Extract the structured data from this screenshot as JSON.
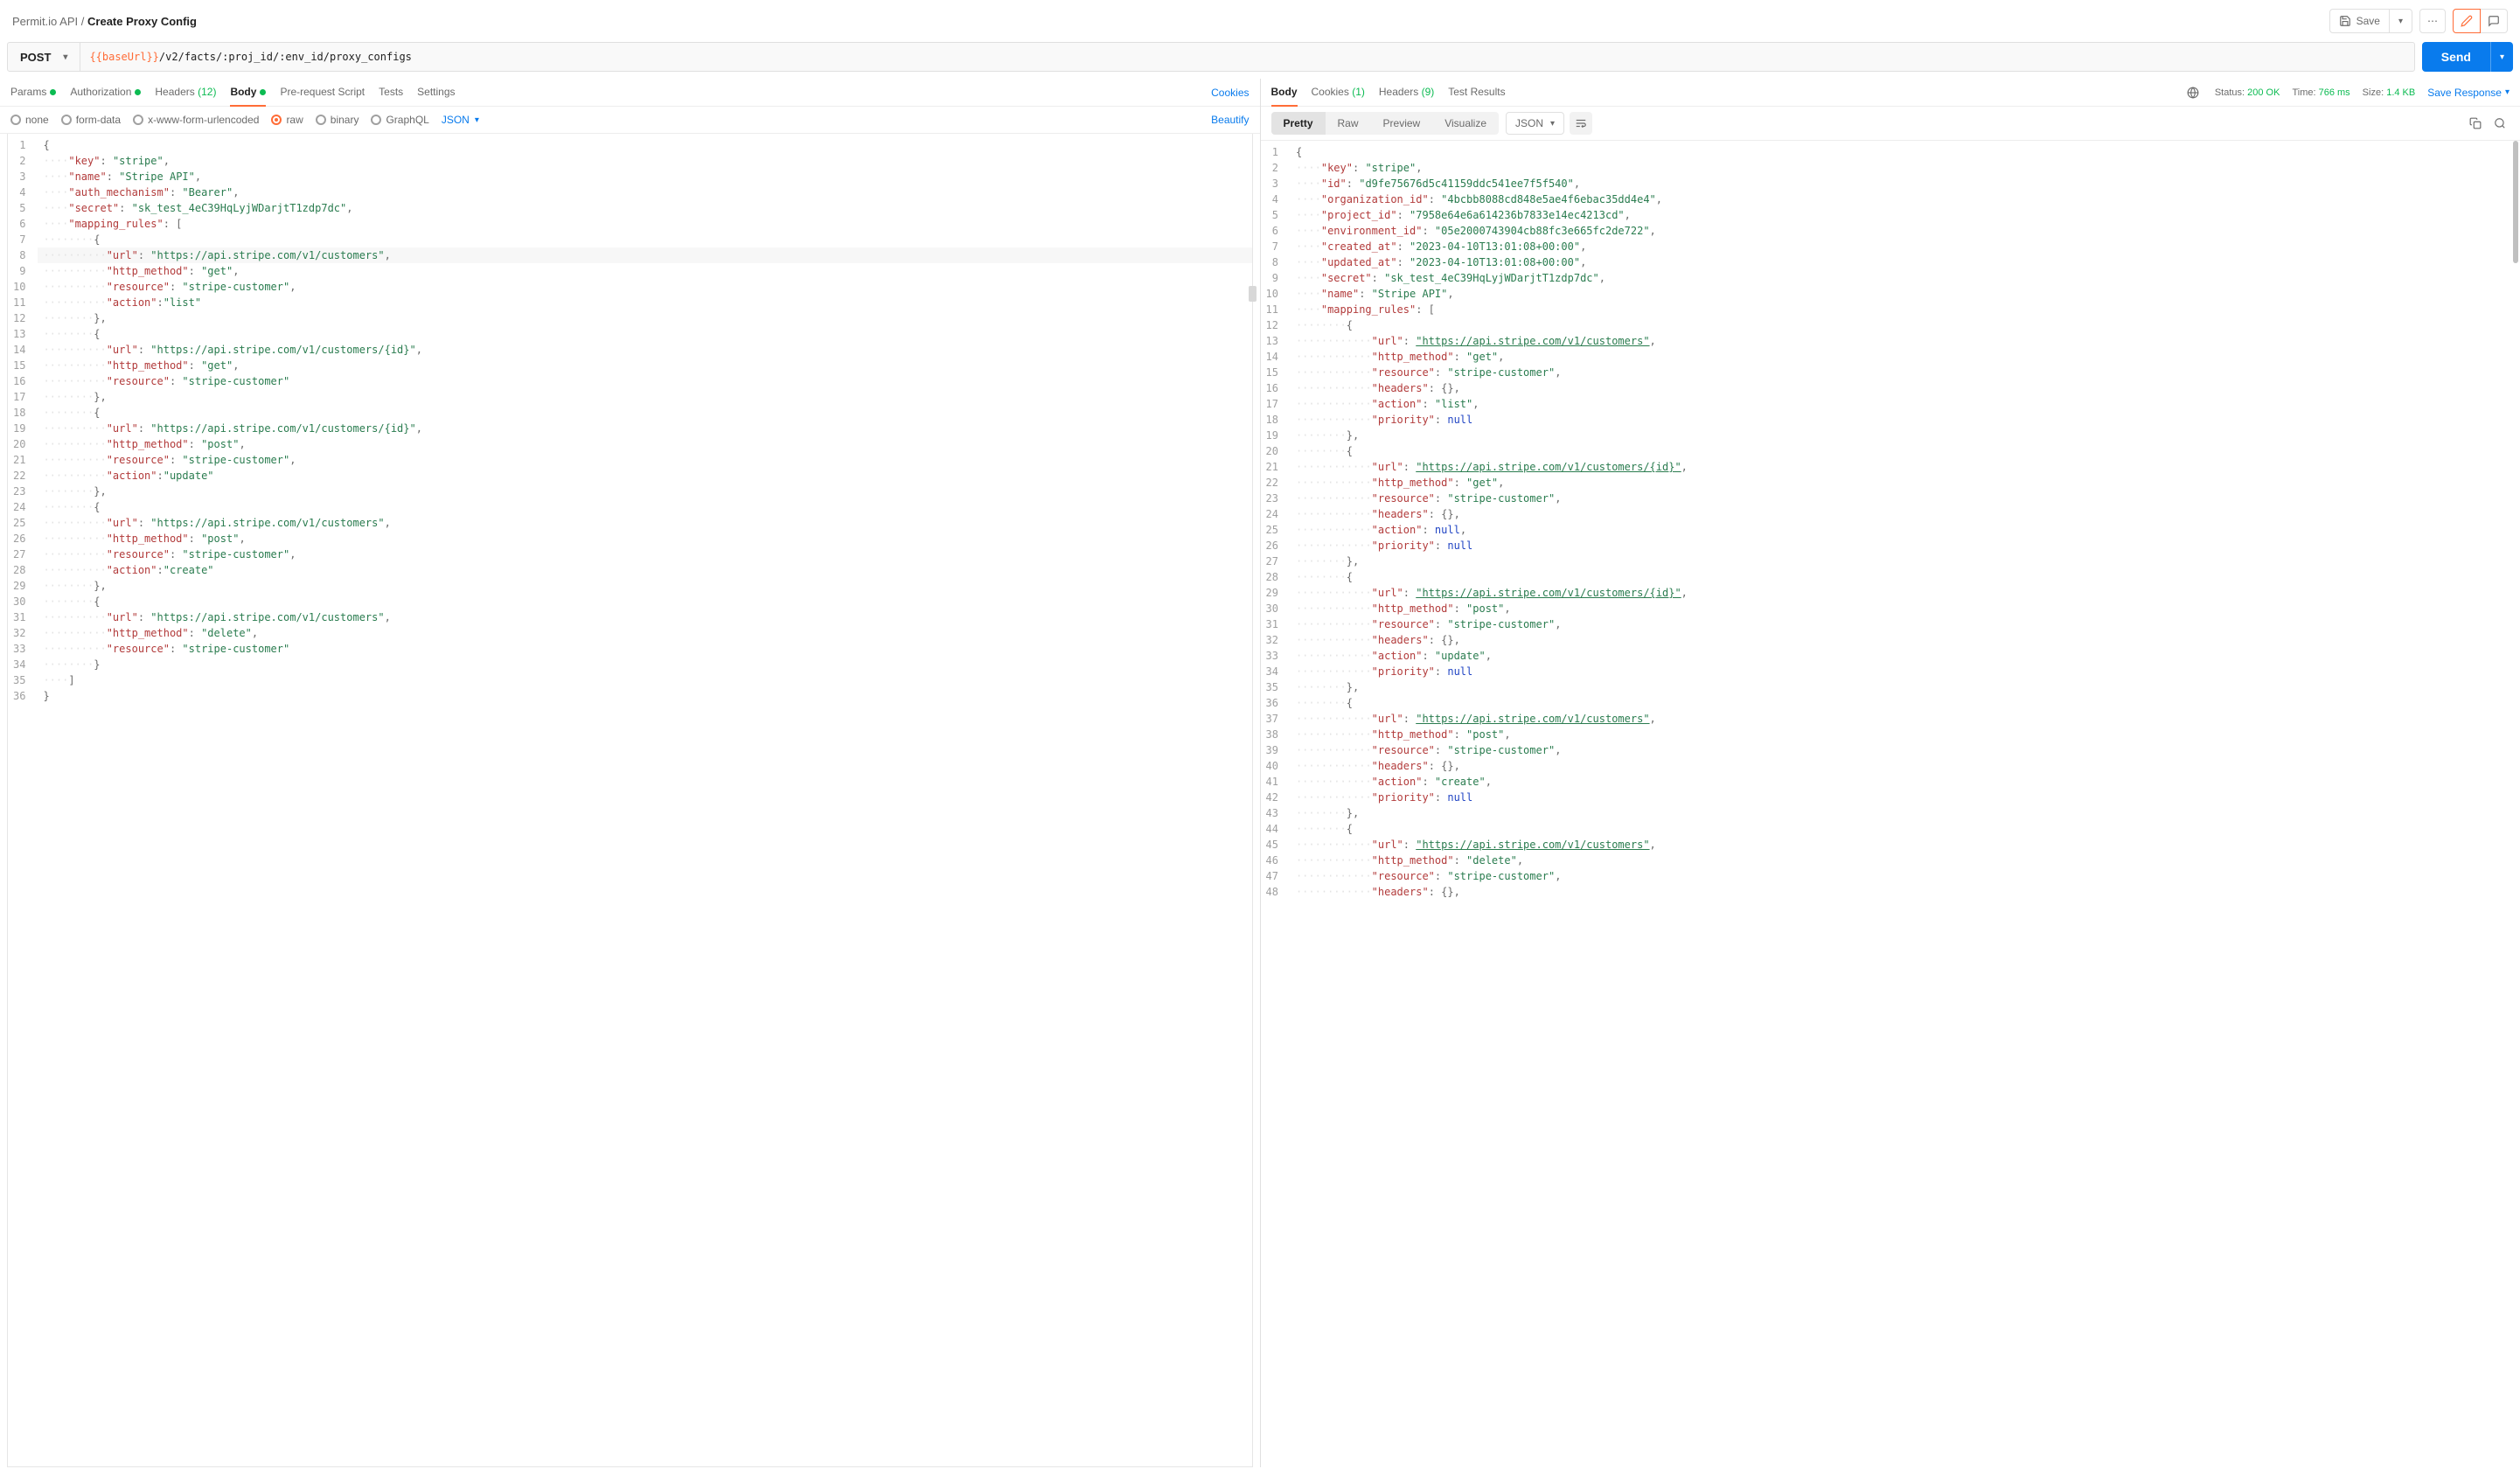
{
  "breadcrumb": {
    "parent": "Permit.io API",
    "sep": "/",
    "current": "Create Proxy Config"
  },
  "header": {
    "save": "Save",
    "more": "⋯"
  },
  "request": {
    "method": "POST",
    "url_var": "{{baseUrl}}",
    "url_path": "/v2/facts/:proj_id/:env_id/proxy_configs",
    "send": "Send"
  },
  "req_tabs": {
    "params": "Params",
    "authorization": "Authorization",
    "headers": "Headers",
    "headers_count": "(12)",
    "body": "Body",
    "prerequest": "Pre-request Script",
    "tests": "Tests",
    "settings": "Settings",
    "cookies": "Cookies"
  },
  "body_radios": {
    "none": "none",
    "formdata": "form-data",
    "xwww": "x-www-form-urlencoded",
    "raw": "raw",
    "binary": "binary",
    "graphql": "GraphQL",
    "json": "JSON",
    "beautify": "Beautify"
  },
  "resp_tabs": {
    "body": "Body",
    "cookies": "Cookies",
    "cookies_count": "(1)",
    "headers": "Headers",
    "headers_count": "(9)",
    "tests": "Test Results"
  },
  "status": {
    "status_label": "Status:",
    "status_value": "200 OK",
    "time_label": "Time:",
    "time_value": "766 ms",
    "size_label": "Size:",
    "size_value": "1.4 KB",
    "save_response": "Save Response"
  },
  "resp_view": {
    "pretty": "Pretty",
    "raw": "Raw",
    "preview": "Preview",
    "visualize": "Visualize",
    "json": "JSON"
  },
  "req_body": [
    [
      [
        "p",
        "{"
      ]
    ],
    [
      [
        "d",
        "····"
      ],
      [
        "k",
        "\"key\""
      ],
      [
        "p",
        ": "
      ],
      [
        "s",
        "\"stripe\""
      ],
      [
        "p",
        ","
      ]
    ],
    [
      [
        "d",
        "····"
      ],
      [
        "k",
        "\"name\""
      ],
      [
        "p",
        ": "
      ],
      [
        "s",
        "\"Stripe API\""
      ],
      [
        "p",
        ","
      ]
    ],
    [
      [
        "d",
        "····"
      ],
      [
        "k",
        "\"auth_mechanism\""
      ],
      [
        "p",
        ": "
      ],
      [
        "s",
        "\"Bearer\""
      ],
      [
        "p",
        ","
      ]
    ],
    [
      [
        "d",
        "····"
      ],
      [
        "k",
        "\"secret\""
      ],
      [
        "p",
        ": "
      ],
      [
        "s",
        "\"sk_test_4eC39HqLyjWDarjtT1zdp7dc\""
      ],
      [
        "p",
        ","
      ]
    ],
    [
      [
        "d",
        "····"
      ],
      [
        "k",
        "\"mapping_rules\""
      ],
      [
        "p",
        ": ["
      ]
    ],
    [
      [
        "d",
        "········"
      ],
      [
        "p",
        "{"
      ]
    ],
    [
      [
        "d",
        "··········"
      ],
      [
        "k",
        "\"url\""
      ],
      [
        "p",
        ": "
      ],
      [
        "s",
        "\"https://api.stripe.com/v1/customers\""
      ],
      [
        "p",
        ","
      ]
    ],
    [
      [
        "d",
        "··········"
      ],
      [
        "k",
        "\"http_method\""
      ],
      [
        "p",
        ": "
      ],
      [
        "s",
        "\"get\""
      ],
      [
        "p",
        ","
      ]
    ],
    [
      [
        "d",
        "··········"
      ],
      [
        "k",
        "\"resource\""
      ],
      [
        "p",
        ": "
      ],
      [
        "s",
        "\"stripe-customer\""
      ],
      [
        "p",
        ","
      ]
    ],
    [
      [
        "d",
        "··········"
      ],
      [
        "k",
        "\"action\""
      ],
      [
        "p",
        ":"
      ],
      [
        "s",
        "\"list\""
      ]
    ],
    [
      [
        "d",
        "········"
      ],
      [
        "p",
        "},"
      ]
    ],
    [
      [
        "d",
        "········"
      ],
      [
        "p",
        "{"
      ]
    ],
    [
      [
        "d",
        "··········"
      ],
      [
        "k",
        "\"url\""
      ],
      [
        "p",
        ": "
      ],
      [
        "s",
        "\"https://api.stripe.com/v1/customers/{id}\""
      ],
      [
        "p",
        ","
      ]
    ],
    [
      [
        "d",
        "··········"
      ],
      [
        "k",
        "\"http_method\""
      ],
      [
        "p",
        ": "
      ],
      [
        "s",
        "\"get\""
      ],
      [
        "p",
        ","
      ]
    ],
    [
      [
        "d",
        "··········"
      ],
      [
        "k",
        "\"resource\""
      ],
      [
        "p",
        ": "
      ],
      [
        "s",
        "\"stripe-customer\""
      ]
    ],
    [
      [
        "d",
        "········"
      ],
      [
        "p",
        "},"
      ]
    ],
    [
      [
        "d",
        "········"
      ],
      [
        "p",
        "{"
      ]
    ],
    [
      [
        "d",
        "··········"
      ],
      [
        "k",
        "\"url\""
      ],
      [
        "p",
        ": "
      ],
      [
        "s",
        "\"https://api.stripe.com/v1/customers/{id}\""
      ],
      [
        "p",
        ","
      ]
    ],
    [
      [
        "d",
        "··········"
      ],
      [
        "k",
        "\"http_method\""
      ],
      [
        "p",
        ": "
      ],
      [
        "s",
        "\"post\""
      ],
      [
        "p",
        ","
      ]
    ],
    [
      [
        "d",
        "··········"
      ],
      [
        "k",
        "\"resource\""
      ],
      [
        "p",
        ": "
      ],
      [
        "s",
        "\"stripe-customer\""
      ],
      [
        "p",
        ","
      ]
    ],
    [
      [
        "d",
        "··········"
      ],
      [
        "k",
        "\"action\""
      ],
      [
        "p",
        ":"
      ],
      [
        "s",
        "\"update\""
      ]
    ],
    [
      [
        "d",
        "········"
      ],
      [
        "p",
        "},"
      ]
    ],
    [
      [
        "d",
        "········"
      ],
      [
        "p",
        "{"
      ]
    ],
    [
      [
        "d",
        "··········"
      ],
      [
        "k",
        "\"url\""
      ],
      [
        "p",
        ": "
      ],
      [
        "s",
        "\"https://api.stripe.com/v1/customers\""
      ],
      [
        "p",
        ","
      ]
    ],
    [
      [
        "d",
        "··········"
      ],
      [
        "k",
        "\"http_method\""
      ],
      [
        "p",
        ": "
      ],
      [
        "s",
        "\"post\""
      ],
      [
        "p",
        ","
      ]
    ],
    [
      [
        "d",
        "··········"
      ],
      [
        "k",
        "\"resource\""
      ],
      [
        "p",
        ": "
      ],
      [
        "s",
        "\"stripe-customer\""
      ],
      [
        "p",
        ","
      ]
    ],
    [
      [
        "d",
        "··········"
      ],
      [
        "k",
        "\"action\""
      ],
      [
        "p",
        ":"
      ],
      [
        "s",
        "\"create\""
      ]
    ],
    [
      [
        "d",
        "········"
      ],
      [
        "p",
        "},"
      ]
    ],
    [
      [
        "d",
        "········"
      ],
      [
        "p",
        "{"
      ]
    ],
    [
      [
        "d",
        "··········"
      ],
      [
        "k",
        "\"url\""
      ],
      [
        "p",
        ": "
      ],
      [
        "s",
        "\"https://api.stripe.com/v1/customers\""
      ],
      [
        "p",
        ","
      ]
    ],
    [
      [
        "d",
        "··········"
      ],
      [
        "k",
        "\"http_method\""
      ],
      [
        "p",
        ": "
      ],
      [
        "s",
        "\"delete\""
      ],
      [
        "p",
        ","
      ]
    ],
    [
      [
        "d",
        "··········"
      ],
      [
        "k",
        "\"resource\""
      ],
      [
        "p",
        ": "
      ],
      [
        "s",
        "\"stripe-customer\""
      ]
    ],
    [
      [
        "d",
        "········"
      ],
      [
        "p",
        "}"
      ]
    ],
    [
      [
        "d",
        "····"
      ],
      [
        "p",
        "]"
      ]
    ],
    [
      [
        "p",
        "}"
      ]
    ]
  ],
  "resp_body": [
    [
      [
        "p",
        "{"
      ]
    ],
    [
      [
        "d",
        "····"
      ],
      [
        "k",
        "\"key\""
      ],
      [
        "p",
        ": "
      ],
      [
        "s",
        "\"stripe\""
      ],
      [
        "p",
        ","
      ]
    ],
    [
      [
        "d",
        "····"
      ],
      [
        "k",
        "\"id\""
      ],
      [
        "p",
        ": "
      ],
      [
        "s",
        "\"d9fe75676d5c41159ddc541ee7f5f540\""
      ],
      [
        "p",
        ","
      ]
    ],
    [
      [
        "d",
        "····"
      ],
      [
        "k",
        "\"organization_id\""
      ],
      [
        "p",
        ": "
      ],
      [
        "s",
        "\"4bcbb8088cd848e5ae4f6ebac35dd4e4\""
      ],
      [
        "p",
        ","
      ]
    ],
    [
      [
        "d",
        "····"
      ],
      [
        "k",
        "\"project_id\""
      ],
      [
        "p",
        ": "
      ],
      [
        "s",
        "\"7958e64e6a614236b7833e14ec4213cd\""
      ],
      [
        "p",
        ","
      ]
    ],
    [
      [
        "d",
        "····"
      ],
      [
        "k",
        "\"environment_id\""
      ],
      [
        "p",
        ": "
      ],
      [
        "s",
        "\"05e2000743904cb88fc3e665fc2de722\""
      ],
      [
        "p",
        ","
      ]
    ],
    [
      [
        "d",
        "····"
      ],
      [
        "k",
        "\"created_at\""
      ],
      [
        "p",
        ": "
      ],
      [
        "s",
        "\"2023-04-10T13:01:08+00:00\""
      ],
      [
        "p",
        ","
      ]
    ],
    [
      [
        "d",
        "····"
      ],
      [
        "k",
        "\"updated_at\""
      ],
      [
        "p",
        ": "
      ],
      [
        "s",
        "\"2023-04-10T13:01:08+00:00\""
      ],
      [
        "p",
        ","
      ]
    ],
    [
      [
        "d",
        "····"
      ],
      [
        "k",
        "\"secret\""
      ],
      [
        "p",
        ": "
      ],
      [
        "s",
        "\"sk_test_4eC39HqLyjWDarjtT1zdp7dc\""
      ],
      [
        "p",
        ","
      ]
    ],
    [
      [
        "d",
        "····"
      ],
      [
        "k",
        "\"name\""
      ],
      [
        "p",
        ": "
      ],
      [
        "s",
        "\"Stripe API\""
      ],
      [
        "p",
        ","
      ]
    ],
    [
      [
        "d",
        "····"
      ],
      [
        "k",
        "\"mapping_rules\""
      ],
      [
        "p",
        ": ["
      ]
    ],
    [
      [
        "d",
        "········"
      ],
      [
        "p",
        "{"
      ]
    ],
    [
      [
        "d",
        "············"
      ],
      [
        "k",
        "\"url\""
      ],
      [
        "p",
        ": "
      ],
      [
        "u",
        "\"https://api.stripe.com/v1/customers\""
      ],
      [
        "p",
        ","
      ]
    ],
    [
      [
        "d",
        "············"
      ],
      [
        "k",
        "\"http_method\""
      ],
      [
        "p",
        ": "
      ],
      [
        "s",
        "\"get\""
      ],
      [
        "p",
        ","
      ]
    ],
    [
      [
        "d",
        "············"
      ],
      [
        "k",
        "\"resource\""
      ],
      [
        "p",
        ": "
      ],
      [
        "s",
        "\"stripe-customer\""
      ],
      [
        "p",
        ","
      ]
    ],
    [
      [
        "d",
        "············"
      ],
      [
        "k",
        "\"headers\""
      ],
      [
        "p",
        ": {},"
      ]
    ],
    [
      [
        "d",
        "············"
      ],
      [
        "k",
        "\"action\""
      ],
      [
        "p",
        ": "
      ],
      [
        "s",
        "\"list\""
      ],
      [
        "p",
        ","
      ]
    ],
    [
      [
        "d",
        "············"
      ],
      [
        "k",
        "\"priority\""
      ],
      [
        "p",
        ": "
      ],
      [
        "nl",
        "null"
      ]
    ],
    [
      [
        "d",
        "········"
      ],
      [
        "p",
        "},"
      ]
    ],
    [
      [
        "d",
        "········"
      ],
      [
        "p",
        "{"
      ]
    ],
    [
      [
        "d",
        "············"
      ],
      [
        "k",
        "\"url\""
      ],
      [
        "p",
        ": "
      ],
      [
        "u",
        "\"https://api.stripe.com/v1/customers/{id}\""
      ],
      [
        "p",
        ","
      ]
    ],
    [
      [
        "d",
        "············"
      ],
      [
        "k",
        "\"http_method\""
      ],
      [
        "p",
        ": "
      ],
      [
        "s",
        "\"get\""
      ],
      [
        "p",
        ","
      ]
    ],
    [
      [
        "d",
        "············"
      ],
      [
        "k",
        "\"resource\""
      ],
      [
        "p",
        ": "
      ],
      [
        "s",
        "\"stripe-customer\""
      ],
      [
        "p",
        ","
      ]
    ],
    [
      [
        "d",
        "············"
      ],
      [
        "k",
        "\"headers\""
      ],
      [
        "p",
        ": {},"
      ]
    ],
    [
      [
        "d",
        "············"
      ],
      [
        "k",
        "\"action\""
      ],
      [
        "p",
        ": "
      ],
      [
        "nl",
        "null"
      ],
      [
        "p",
        ","
      ]
    ],
    [
      [
        "d",
        "············"
      ],
      [
        "k",
        "\"priority\""
      ],
      [
        "p",
        ": "
      ],
      [
        "nl",
        "null"
      ]
    ],
    [
      [
        "d",
        "········"
      ],
      [
        "p",
        "},"
      ]
    ],
    [
      [
        "d",
        "········"
      ],
      [
        "p",
        "{"
      ]
    ],
    [
      [
        "d",
        "············"
      ],
      [
        "k",
        "\"url\""
      ],
      [
        "p",
        ": "
      ],
      [
        "u",
        "\"https://api.stripe.com/v1/customers/{id}\""
      ],
      [
        "p",
        ","
      ]
    ],
    [
      [
        "d",
        "············"
      ],
      [
        "k",
        "\"http_method\""
      ],
      [
        "p",
        ": "
      ],
      [
        "s",
        "\"post\""
      ],
      [
        "p",
        ","
      ]
    ],
    [
      [
        "d",
        "············"
      ],
      [
        "k",
        "\"resource\""
      ],
      [
        "p",
        ": "
      ],
      [
        "s",
        "\"stripe-customer\""
      ],
      [
        "p",
        ","
      ]
    ],
    [
      [
        "d",
        "············"
      ],
      [
        "k",
        "\"headers\""
      ],
      [
        "p",
        ": {},"
      ]
    ],
    [
      [
        "d",
        "············"
      ],
      [
        "k",
        "\"action\""
      ],
      [
        "p",
        ": "
      ],
      [
        "s",
        "\"update\""
      ],
      [
        "p",
        ","
      ]
    ],
    [
      [
        "d",
        "············"
      ],
      [
        "k",
        "\"priority\""
      ],
      [
        "p",
        ": "
      ],
      [
        "nl",
        "null"
      ]
    ],
    [
      [
        "d",
        "········"
      ],
      [
        "p",
        "},"
      ]
    ],
    [
      [
        "d",
        "········"
      ],
      [
        "p",
        "{"
      ]
    ],
    [
      [
        "d",
        "············"
      ],
      [
        "k",
        "\"url\""
      ],
      [
        "p",
        ": "
      ],
      [
        "u",
        "\"https://api.stripe.com/v1/customers\""
      ],
      [
        "p",
        ","
      ]
    ],
    [
      [
        "d",
        "············"
      ],
      [
        "k",
        "\"http_method\""
      ],
      [
        "p",
        ": "
      ],
      [
        "s",
        "\"post\""
      ],
      [
        "p",
        ","
      ]
    ],
    [
      [
        "d",
        "············"
      ],
      [
        "k",
        "\"resource\""
      ],
      [
        "p",
        ": "
      ],
      [
        "s",
        "\"stripe-customer\""
      ],
      [
        "p",
        ","
      ]
    ],
    [
      [
        "d",
        "············"
      ],
      [
        "k",
        "\"headers\""
      ],
      [
        "p",
        ": {},"
      ]
    ],
    [
      [
        "d",
        "············"
      ],
      [
        "k",
        "\"action\""
      ],
      [
        "p",
        ": "
      ],
      [
        "s",
        "\"create\""
      ],
      [
        "p",
        ","
      ]
    ],
    [
      [
        "d",
        "············"
      ],
      [
        "k",
        "\"priority\""
      ],
      [
        "p",
        ": "
      ],
      [
        "nl",
        "null"
      ]
    ],
    [
      [
        "d",
        "········"
      ],
      [
        "p",
        "},"
      ]
    ],
    [
      [
        "d",
        "········"
      ],
      [
        "p",
        "{"
      ]
    ],
    [
      [
        "d",
        "············"
      ],
      [
        "k",
        "\"url\""
      ],
      [
        "p",
        ": "
      ],
      [
        "u",
        "\"https://api.stripe.com/v1/customers\""
      ],
      [
        "p",
        ","
      ]
    ],
    [
      [
        "d",
        "············"
      ],
      [
        "k",
        "\"http_method\""
      ],
      [
        "p",
        ": "
      ],
      [
        "s",
        "\"delete\""
      ],
      [
        "p",
        ","
      ]
    ],
    [
      [
        "d",
        "············"
      ],
      [
        "k",
        "\"resource\""
      ],
      [
        "p",
        ": "
      ],
      [
        "s",
        "\"stripe-customer\""
      ],
      [
        "p",
        ","
      ]
    ],
    [
      [
        "d",
        "············"
      ],
      [
        "k",
        "\"headers\""
      ],
      [
        "p",
        ": {},"
      ]
    ]
  ]
}
